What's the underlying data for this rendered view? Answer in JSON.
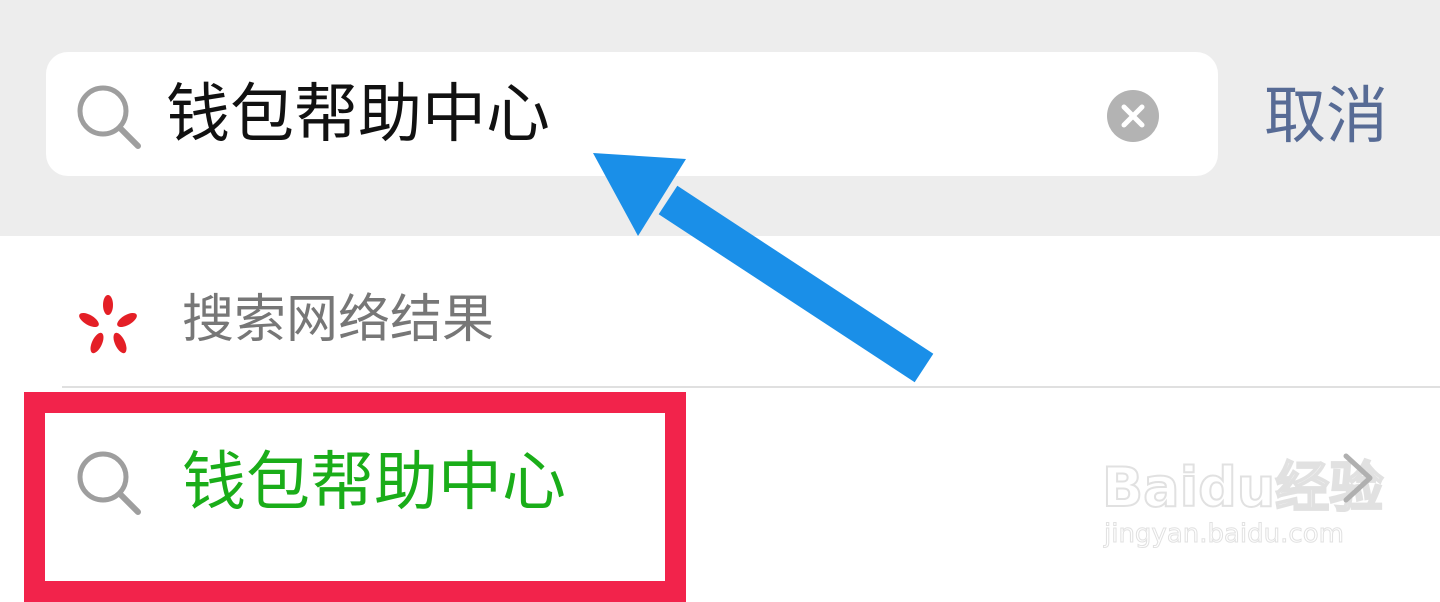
{
  "search": {
    "query": "钱包帮助中心",
    "cancel_label": "取消"
  },
  "web_search": {
    "label": "搜索网络结果"
  },
  "suggestion": {
    "label": "钱包帮助中心"
  },
  "watermark": {
    "brand": "Baidu经验",
    "url": "jingyan.baidu.com"
  },
  "icons": {
    "search": "search-icon",
    "clear": "clear-icon",
    "web": "web-search-icon",
    "chevron": "chevron-right-icon"
  },
  "colors": {
    "top_bar": "#ededed",
    "cancel": "#576b95",
    "suggestion": "#1aad19",
    "highlight": "#f2234b",
    "arrow": "#1a8fe8",
    "web_icon": "#e41f26"
  }
}
